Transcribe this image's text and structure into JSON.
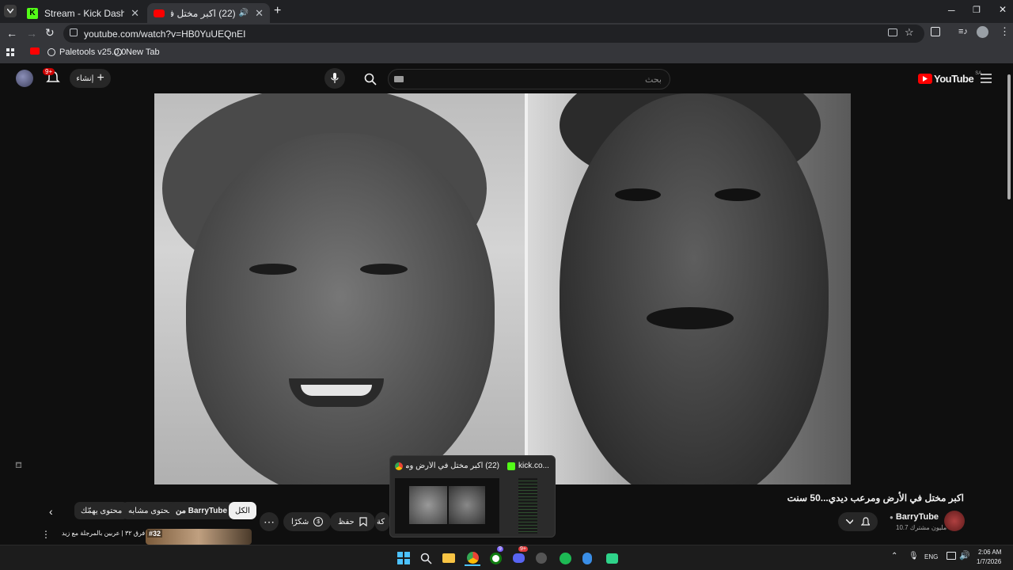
{
  "browser": {
    "tabs": [
      {
        "title": "Stream - Kick Dashboard",
        "active": false
      },
      {
        "title": "(22) اكبر مختل في الأرض ومـ...",
        "active": true
      }
    ],
    "new_tab": "+",
    "url": "youtube.com/watch?v=HB0YuUEQnEI",
    "bookmarks": [
      {
        "label": "Paletools v25.0.0"
      },
      {
        "label": "New Tab"
      }
    ]
  },
  "youtube": {
    "logo_text": "YouTube",
    "region": "SA",
    "search_placeholder": "بحث",
    "create_label": "إنشاء",
    "notif_badge": "9+",
    "video": {
      "title": "اكبر مختل في الأرض ومرعب ديدي...50 سنت"
    },
    "channel": {
      "name": "BarryTube",
      "subs": "10.7 مليون مشترك"
    },
    "actions": {
      "thanks": "شكرًا",
      "save": "حفظ",
      "share_partial": "كة"
    },
    "chips": [
      {
        "label": "الكل",
        "selected": true
      },
      {
        "label": "من BarryTube",
        "selected": false
      },
      {
        "label": "محتوى مشابه",
        "selected": false
      },
      {
        "label": "محتوى يهمّك",
        "selected": false
      }
    ],
    "rec": {
      "badge": "#32",
      "title": "فرق ٣٢ | عربين بالمرجلة مع زيد"
    }
  },
  "taskbar_preview": {
    "items": [
      {
        "title": "(22) اكبر مختل في الأرض ومـ..."
      },
      {
        "title": "kick.co..."
      }
    ]
  },
  "tray": {
    "lang": "ENG",
    "time": "2:06 AM",
    "date": "1/7/2026",
    "badge_a": "9",
    "badge_b": "9+"
  },
  "colors": {
    "yt_red": "#ff0000",
    "kick_green": "#53fc18",
    "chrome_dark": "#202124"
  }
}
